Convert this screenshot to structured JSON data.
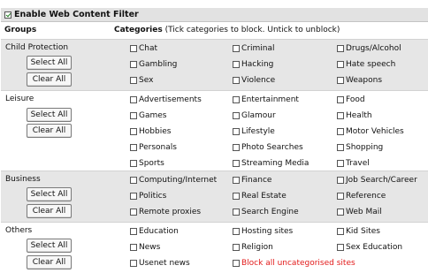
{
  "filter": {
    "enabled": true,
    "title": "Enable Web Content Filter"
  },
  "headers": {
    "groups": "Groups",
    "categories_bold": "Categories",
    "categories_note": " (Tick categories to block. Untick to unblock)"
  },
  "buttons": {
    "select_all": "Select All",
    "clear_all": "Clear All"
  },
  "groups": [
    {
      "name": "Child Protection",
      "categories": [
        {
          "label": "Chat",
          "checked": false
        },
        {
          "label": "Criminal",
          "checked": false
        },
        {
          "label": "Drugs/Alcohol",
          "checked": false
        },
        {
          "label": "Gambling",
          "checked": false
        },
        {
          "label": "Hacking",
          "checked": false
        },
        {
          "label": "Hate speech",
          "checked": false
        },
        {
          "label": "Sex",
          "checked": false
        },
        {
          "label": "Violence",
          "checked": false
        },
        {
          "label": "Weapons",
          "checked": false
        }
      ]
    },
    {
      "name": "Leisure",
      "categories": [
        {
          "label": "Advertisements",
          "checked": false
        },
        {
          "label": "Entertainment",
          "checked": false
        },
        {
          "label": "Food",
          "checked": false
        },
        {
          "label": "Games",
          "checked": false
        },
        {
          "label": "Glamour",
          "checked": false
        },
        {
          "label": "Health",
          "checked": false
        },
        {
          "label": "Hobbies",
          "checked": false
        },
        {
          "label": "Lifestyle",
          "checked": false
        },
        {
          "label": "Motor Vehicles",
          "checked": false
        },
        {
          "label": "Personals",
          "checked": false
        },
        {
          "label": "Photo Searches",
          "checked": false
        },
        {
          "label": "Shopping",
          "checked": false
        },
        {
          "label": "Sports",
          "checked": false
        },
        {
          "label": "Streaming Media",
          "checked": false
        },
        {
          "label": "Travel",
          "checked": false
        }
      ]
    },
    {
      "name": "Business",
      "categories": [
        {
          "label": "Computing/Internet",
          "checked": false
        },
        {
          "label": "Finance",
          "checked": false
        },
        {
          "label": "Job Search/Career",
          "checked": false
        },
        {
          "label": "Politics",
          "checked": false
        },
        {
          "label": "Real Estate",
          "checked": false
        },
        {
          "label": "Reference",
          "checked": false
        },
        {
          "label": "Remote proxies",
          "checked": false
        },
        {
          "label": "Search Engine",
          "checked": false
        },
        {
          "label": "Web Mail",
          "checked": false
        }
      ]
    },
    {
      "name": "Others",
      "categories": [
        {
          "label": "Education",
          "checked": false
        },
        {
          "label": "Hosting sites",
          "checked": false
        },
        {
          "label": "Kid Sites",
          "checked": false
        },
        {
          "label": "News",
          "checked": false
        },
        {
          "label": "Religion",
          "checked": false
        },
        {
          "label": "Sex Education",
          "checked": false
        },
        {
          "label": "Usenet news",
          "checked": false
        },
        {
          "label": "Block all uncategorised sites",
          "checked": false,
          "highlight": "#e21b1b"
        }
      ]
    }
  ]
}
